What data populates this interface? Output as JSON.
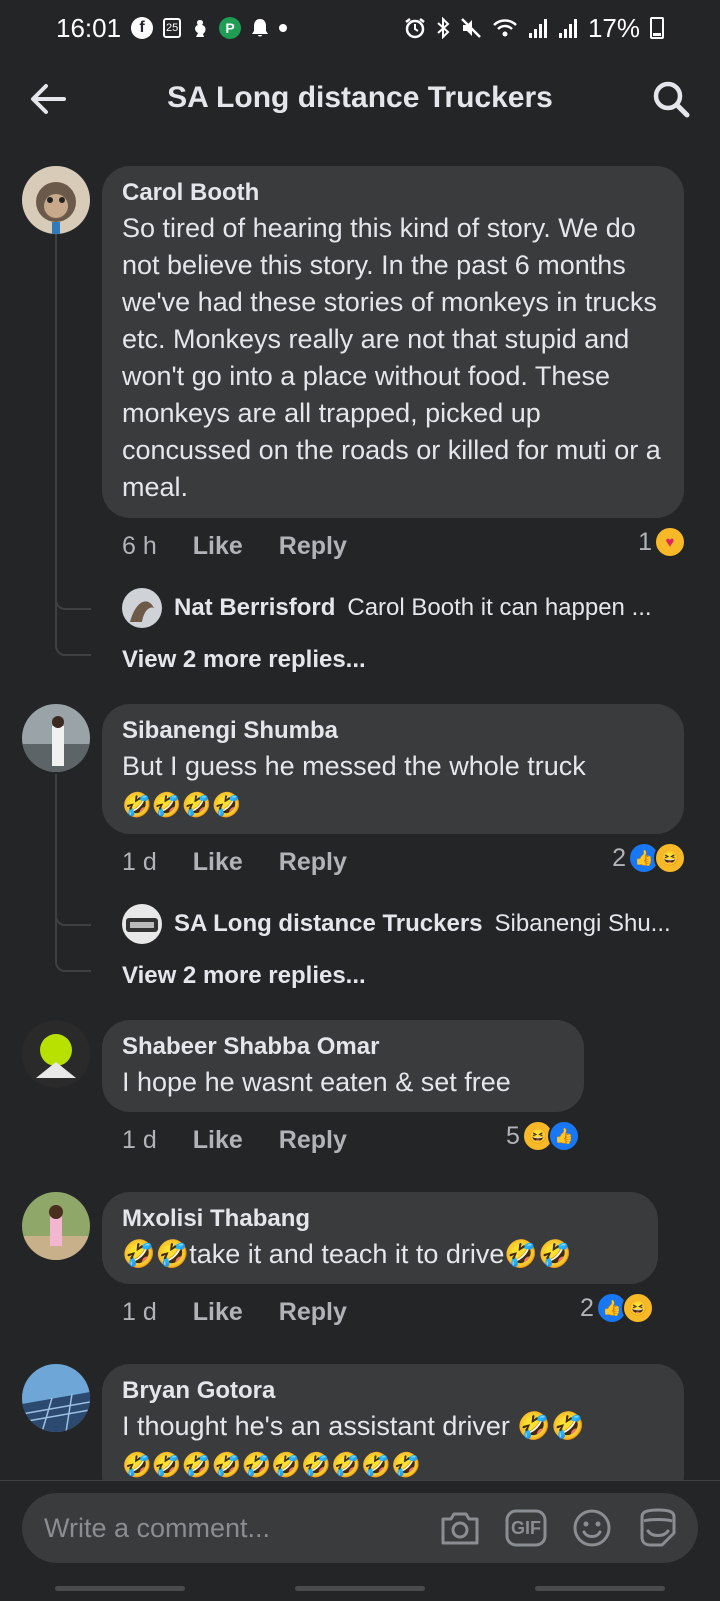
{
  "status_bar": {
    "time": "16:01",
    "battery": "17%",
    "calendar_day": "25",
    "left_icons": [
      "facebook-icon",
      "calendar-icon",
      "bird-icon",
      "vpn-icon",
      "bell-icon",
      "dot-icon"
    ],
    "right_icons": [
      "alarm-icon",
      "bluetooth-icon",
      "mute-icon",
      "wifi-icon",
      "signal-icon",
      "signal-icon",
      "battery-icon"
    ]
  },
  "header": {
    "title": "SA Long distance Truckers",
    "back_icon": "arrow-left-icon",
    "search_icon": "search-icon"
  },
  "comments": [
    {
      "author": "Carol Booth",
      "text": "So tired of hearing this kind of story. We do not believe this story. In the past 6 months we've had these stories of monkeys in trucks etc. Monkeys really are not that stupid and won't go into a place without food. These monkeys are all trapped, picked up concussed on the roads or killed for muti or a meal.",
      "time": "6 h",
      "like": "Like",
      "reply": "Reply",
      "reaction_count": "1",
      "reactions": [
        "care"
      ],
      "reply_preview": {
        "author": "Nat Berrisford",
        "text": "Carol Booth it can happen ..."
      },
      "more_replies": "View 2 more replies..."
    },
    {
      "author": "Sibanengi Shumba",
      "text": "But I guess he messed the whole truck",
      "emoji_line": "🤣🤣🤣🤣",
      "time": "1 d",
      "like": "Like",
      "reply": "Reply",
      "reaction_count": "2",
      "reactions": [
        "like",
        "haha"
      ],
      "reply_preview": {
        "author": "SA Long distance Truckers",
        "text": "Sibanengi Shu..."
      },
      "more_replies": "View 2 more replies..."
    },
    {
      "author": "Shabeer Shabba Omar",
      "text": "I hope he wasnt eaten & set free",
      "time": "1 d",
      "like": "Like",
      "reply": "Reply",
      "reaction_count": "5",
      "reactions": [
        "haha",
        "like"
      ]
    },
    {
      "author": "Mxolisi Thabang",
      "text": "🤣🤣take it and teach it to drive🤣🤣",
      "time": "1 d",
      "like": "Like",
      "reply": "Reply",
      "reaction_count": "2",
      "reactions": [
        "like",
        "haha"
      ]
    },
    {
      "author": "Bryan Gotora",
      "text": "I thought he's an assistant driver 🤣🤣",
      "emoji_line": "🤣🤣🤣🤣🤣🤣🤣🤣🤣🤣"
    }
  ],
  "composer": {
    "placeholder": "Write a comment...",
    "icons": [
      "camera-icon",
      "gif-icon",
      "emoji-icon",
      "sticker-icon"
    ],
    "gif_label": "GIF"
  },
  "colors": {
    "background": "#242526",
    "bubble": "#3a3b3c",
    "text_primary": "#e4e6eb",
    "text_secondary": "#b0b3b8",
    "like_blue": "#1877f2",
    "haha_yellow": "#f7b928"
  }
}
